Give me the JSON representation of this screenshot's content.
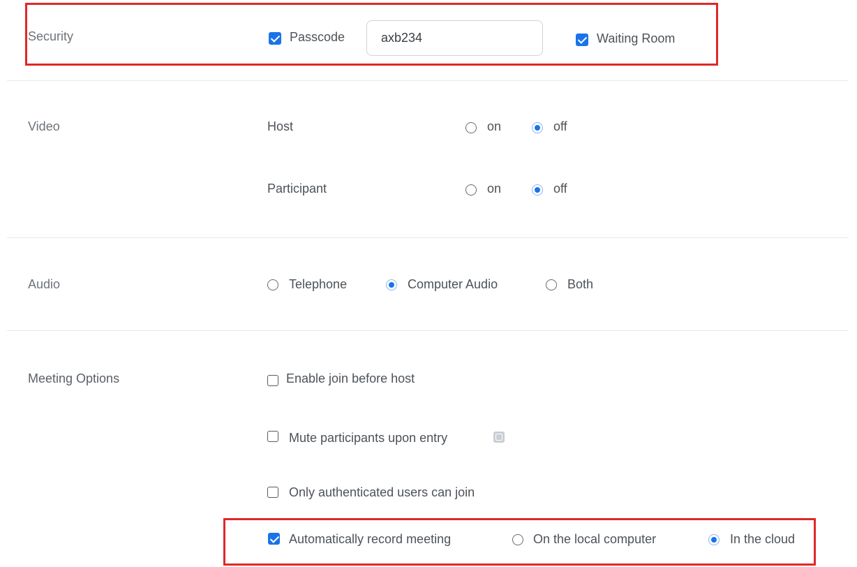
{
  "security": {
    "label": "Security",
    "passcode_label": "Passcode",
    "passcode_checked": true,
    "passcode_value": "axb234",
    "waiting_room_label": "Waiting Room",
    "waiting_room_checked": true
  },
  "video": {
    "label": "Video",
    "host_label": "Host",
    "host_on_label": "on",
    "host_off_label": "off",
    "host_selected": "off",
    "participant_label": "Participant",
    "participant_on_label": "on",
    "participant_off_label": "off",
    "participant_selected": "off"
  },
  "audio": {
    "label": "Audio",
    "options": [
      "Telephone",
      "Computer Audio",
      "Both"
    ],
    "selected": "Computer Audio"
  },
  "meeting_options": {
    "label": "Meeting Options",
    "enable_join_before_host": {
      "label": "Enable join before host",
      "checked": false
    },
    "mute_on_entry": {
      "label": "Mute participants upon entry",
      "checked": false,
      "icon": "info-icon"
    },
    "authenticated_only": {
      "label": "Only authenticated users can join",
      "checked": false
    },
    "auto_record": {
      "label": "Automatically record meeting",
      "checked": true,
      "local_label": "On the local computer",
      "cloud_label": "In the cloud",
      "selected": "In the cloud"
    }
  },
  "colors": {
    "accent": "#1a73e8",
    "highlight": "#e02828",
    "divider": "#e6e8eb"
  }
}
